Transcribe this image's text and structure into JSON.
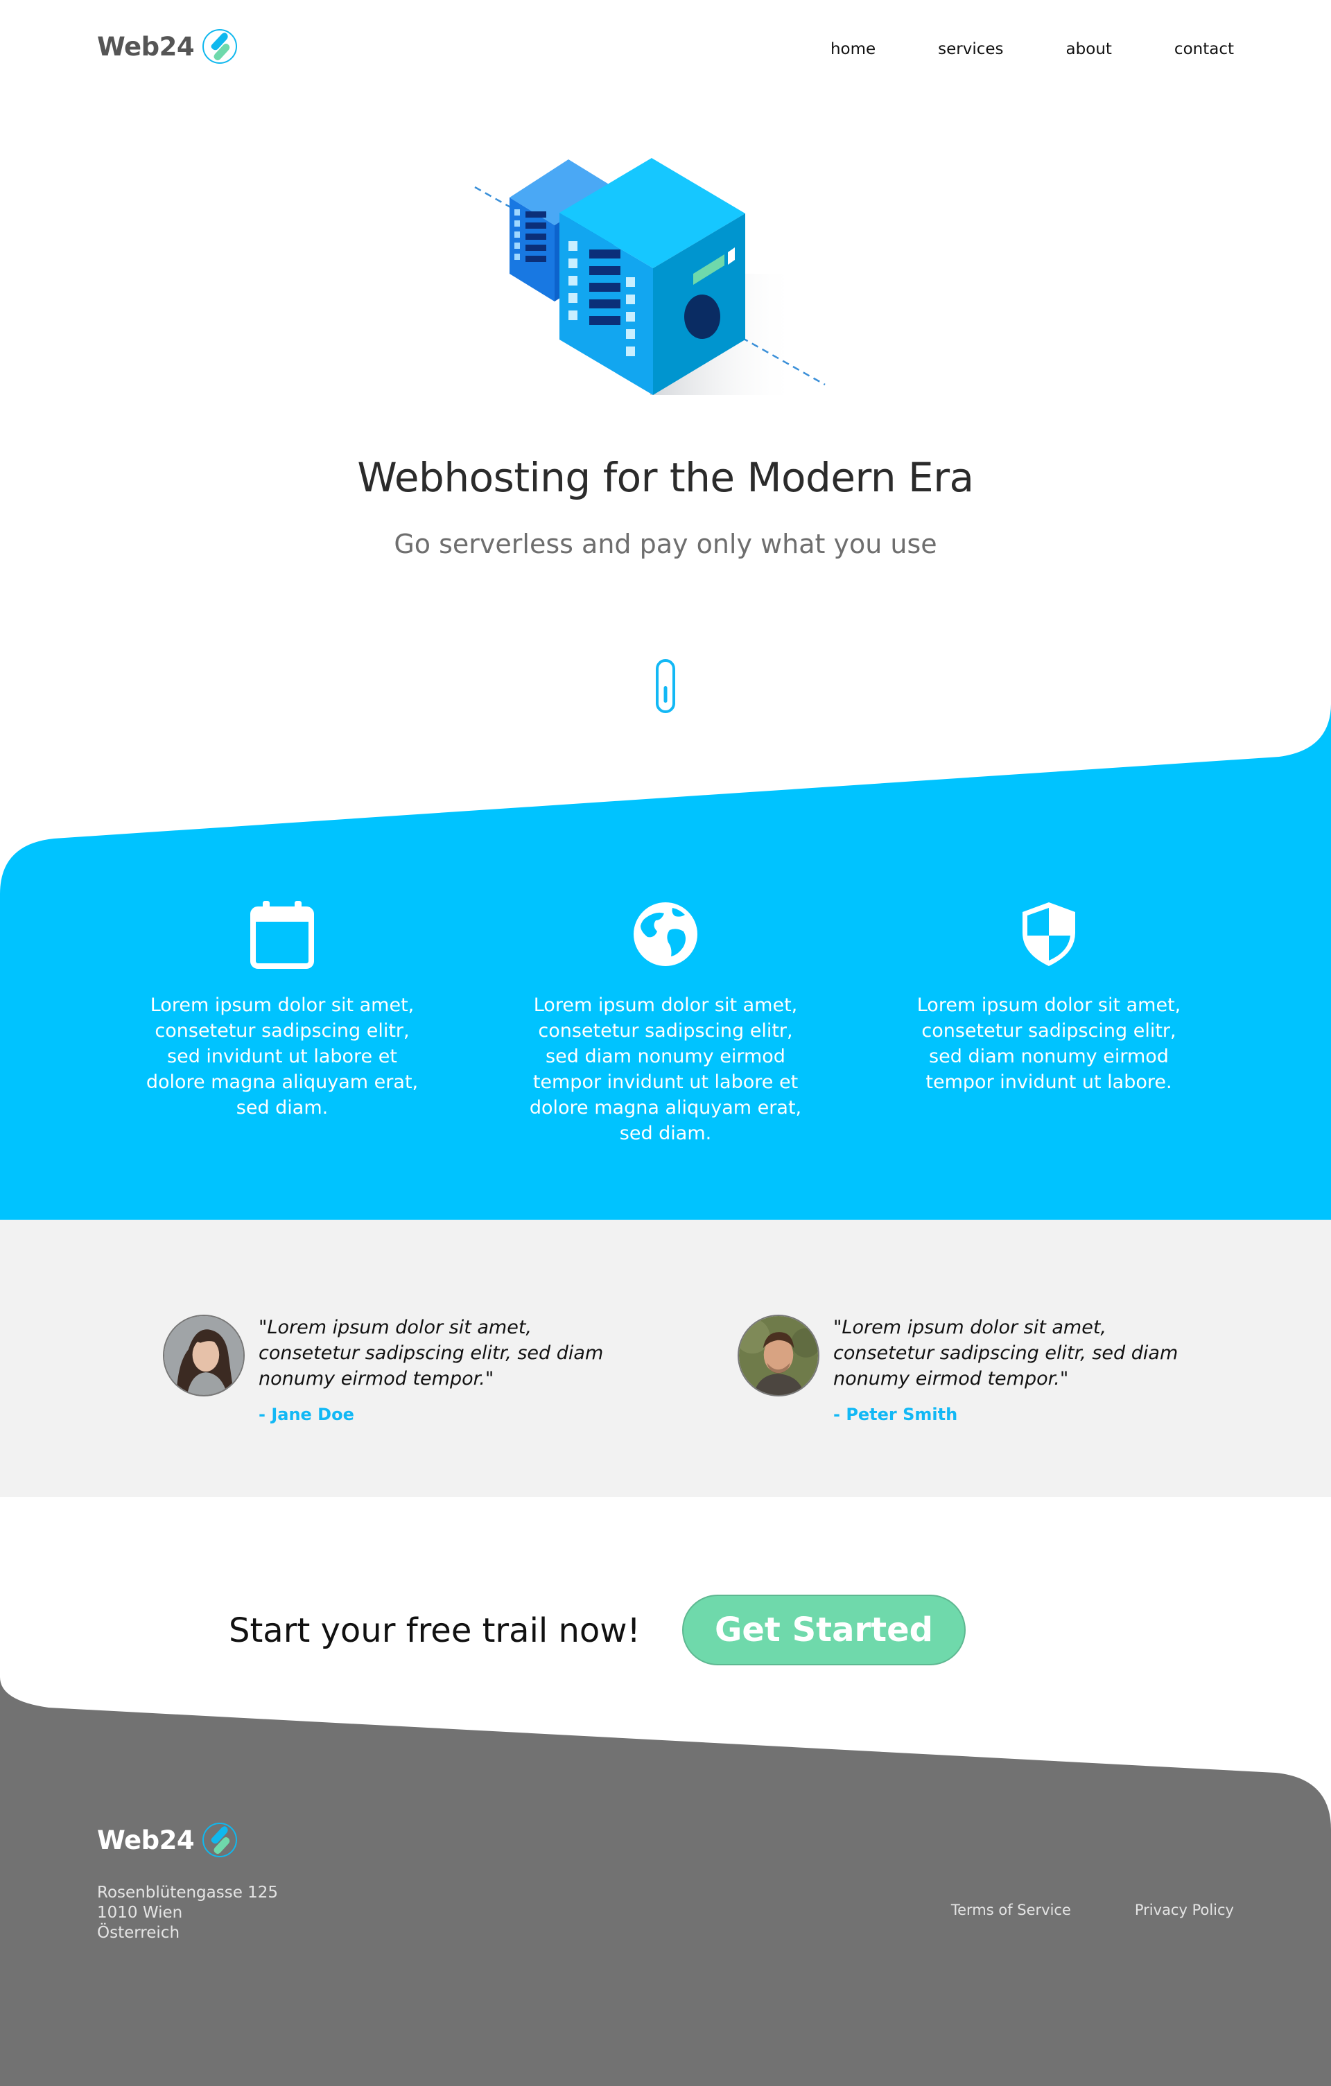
{
  "brand": {
    "name": "Web24"
  },
  "nav": {
    "items": [
      "home",
      "services",
      "about",
      "contact"
    ]
  },
  "hero": {
    "title": "Webhosting for the Modern Era",
    "subtitle": "Go serverless and pay only what you use"
  },
  "features": [
    {
      "icon": "calendar-icon",
      "text": "Lorem ipsum dolor sit amet, consetetur sadipscing elitr, sed invidunt ut labore et dolore magna aliquyam erat, sed diam."
    },
    {
      "icon": "globe-icon",
      "text": "Lorem ipsum dolor sit amet, consetetur sadipscing elitr, sed diam nonumy eirmod tempor invidunt ut labore et dolore magna aliquyam erat, sed diam."
    },
    {
      "icon": "shield-icon",
      "text": "Lorem ipsum dolor sit amet, consetetur sadipscing elitr, sed diam nonumy eirmod tempor invidunt ut labore."
    }
  ],
  "testimonials": [
    {
      "quote": "\"Lorem ipsum dolor sit amet, consetetur sadipscing elitr, sed diam nonumy eirmod tempor.\"",
      "author": "- Jane Doe"
    },
    {
      "quote": "\"Lorem ipsum dolor sit amet, consetetur sadipscing elitr, sed diam nonumy eirmod tempor.\"",
      "author": "- Peter Smith"
    }
  ],
  "cta": {
    "text": "Start your free trail now!",
    "button": "Get Started"
  },
  "footer": {
    "address": [
      "Rosenblütengasse 125",
      "1010 Wien",
      "Österreich"
    ],
    "links": [
      "Terms of Service",
      "Privacy Policy"
    ]
  },
  "colors": {
    "accent": "#00c3ff",
    "cta_green": "#6fd9ab",
    "footer_gray": "#727272",
    "testimonial_bg": "#f2f2f2"
  }
}
